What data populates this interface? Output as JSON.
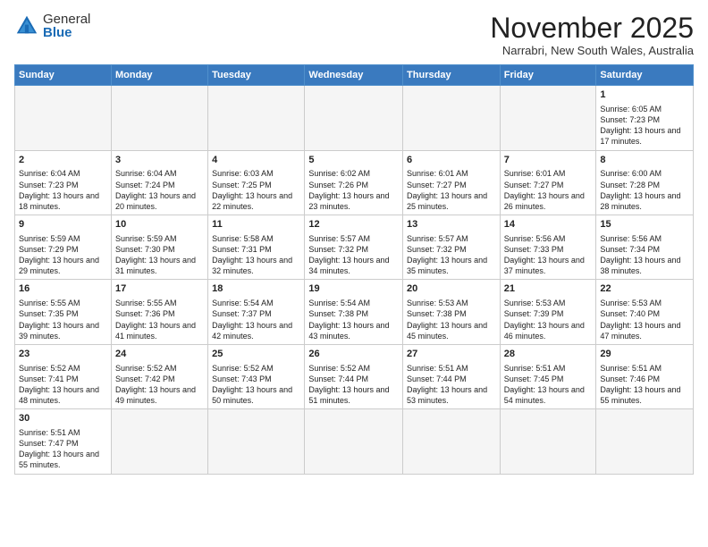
{
  "logo": {
    "general": "General",
    "blue": "Blue"
  },
  "header": {
    "month": "November 2025",
    "location": "Narrabri, New South Wales, Australia"
  },
  "weekdays": [
    "Sunday",
    "Monday",
    "Tuesday",
    "Wednesday",
    "Thursday",
    "Friday",
    "Saturday"
  ],
  "weeks": [
    [
      {
        "day": "",
        "info": ""
      },
      {
        "day": "",
        "info": ""
      },
      {
        "day": "",
        "info": ""
      },
      {
        "day": "",
        "info": ""
      },
      {
        "day": "",
        "info": ""
      },
      {
        "day": "",
        "info": ""
      },
      {
        "day": "1",
        "info": "Sunrise: 6:05 AM\nSunset: 7:23 PM\nDaylight: 13 hours and 17 minutes."
      }
    ],
    [
      {
        "day": "2",
        "info": "Sunrise: 6:04 AM\nSunset: 7:23 PM\nDaylight: 13 hours and 18 minutes."
      },
      {
        "day": "3",
        "info": "Sunrise: 6:04 AM\nSunset: 7:24 PM\nDaylight: 13 hours and 20 minutes."
      },
      {
        "day": "4",
        "info": "Sunrise: 6:03 AM\nSunset: 7:25 PM\nDaylight: 13 hours and 22 minutes."
      },
      {
        "day": "5",
        "info": "Sunrise: 6:02 AM\nSunset: 7:26 PM\nDaylight: 13 hours and 23 minutes."
      },
      {
        "day": "6",
        "info": "Sunrise: 6:01 AM\nSunset: 7:27 PM\nDaylight: 13 hours and 25 minutes."
      },
      {
        "day": "7",
        "info": "Sunrise: 6:01 AM\nSunset: 7:27 PM\nDaylight: 13 hours and 26 minutes."
      },
      {
        "day": "8",
        "info": "Sunrise: 6:00 AM\nSunset: 7:28 PM\nDaylight: 13 hours and 28 minutes."
      }
    ],
    [
      {
        "day": "9",
        "info": "Sunrise: 5:59 AM\nSunset: 7:29 PM\nDaylight: 13 hours and 29 minutes."
      },
      {
        "day": "10",
        "info": "Sunrise: 5:59 AM\nSunset: 7:30 PM\nDaylight: 13 hours and 31 minutes."
      },
      {
        "day": "11",
        "info": "Sunrise: 5:58 AM\nSunset: 7:31 PM\nDaylight: 13 hours and 32 minutes."
      },
      {
        "day": "12",
        "info": "Sunrise: 5:57 AM\nSunset: 7:32 PM\nDaylight: 13 hours and 34 minutes."
      },
      {
        "day": "13",
        "info": "Sunrise: 5:57 AM\nSunset: 7:32 PM\nDaylight: 13 hours and 35 minutes."
      },
      {
        "day": "14",
        "info": "Sunrise: 5:56 AM\nSunset: 7:33 PM\nDaylight: 13 hours and 37 minutes."
      },
      {
        "day": "15",
        "info": "Sunrise: 5:56 AM\nSunset: 7:34 PM\nDaylight: 13 hours and 38 minutes."
      }
    ],
    [
      {
        "day": "16",
        "info": "Sunrise: 5:55 AM\nSunset: 7:35 PM\nDaylight: 13 hours and 39 minutes."
      },
      {
        "day": "17",
        "info": "Sunrise: 5:55 AM\nSunset: 7:36 PM\nDaylight: 13 hours and 41 minutes."
      },
      {
        "day": "18",
        "info": "Sunrise: 5:54 AM\nSunset: 7:37 PM\nDaylight: 13 hours and 42 minutes."
      },
      {
        "day": "19",
        "info": "Sunrise: 5:54 AM\nSunset: 7:38 PM\nDaylight: 13 hours and 43 minutes."
      },
      {
        "day": "20",
        "info": "Sunrise: 5:53 AM\nSunset: 7:38 PM\nDaylight: 13 hours and 45 minutes."
      },
      {
        "day": "21",
        "info": "Sunrise: 5:53 AM\nSunset: 7:39 PM\nDaylight: 13 hours and 46 minutes."
      },
      {
        "day": "22",
        "info": "Sunrise: 5:53 AM\nSunset: 7:40 PM\nDaylight: 13 hours and 47 minutes."
      }
    ],
    [
      {
        "day": "23",
        "info": "Sunrise: 5:52 AM\nSunset: 7:41 PM\nDaylight: 13 hours and 48 minutes."
      },
      {
        "day": "24",
        "info": "Sunrise: 5:52 AM\nSunset: 7:42 PM\nDaylight: 13 hours and 49 minutes."
      },
      {
        "day": "25",
        "info": "Sunrise: 5:52 AM\nSunset: 7:43 PM\nDaylight: 13 hours and 50 minutes."
      },
      {
        "day": "26",
        "info": "Sunrise: 5:52 AM\nSunset: 7:44 PM\nDaylight: 13 hours and 51 minutes."
      },
      {
        "day": "27",
        "info": "Sunrise: 5:51 AM\nSunset: 7:44 PM\nDaylight: 13 hours and 53 minutes."
      },
      {
        "day": "28",
        "info": "Sunrise: 5:51 AM\nSunset: 7:45 PM\nDaylight: 13 hours and 54 minutes."
      },
      {
        "day": "29",
        "info": "Sunrise: 5:51 AM\nSunset: 7:46 PM\nDaylight: 13 hours and 55 minutes."
      }
    ],
    [
      {
        "day": "30",
        "info": "Sunrise: 5:51 AM\nSunset: 7:47 PM\nDaylight: 13 hours and 55 minutes."
      },
      {
        "day": "",
        "info": ""
      },
      {
        "day": "",
        "info": ""
      },
      {
        "day": "",
        "info": ""
      },
      {
        "day": "",
        "info": ""
      },
      {
        "day": "",
        "info": ""
      },
      {
        "day": "",
        "info": ""
      }
    ]
  ]
}
